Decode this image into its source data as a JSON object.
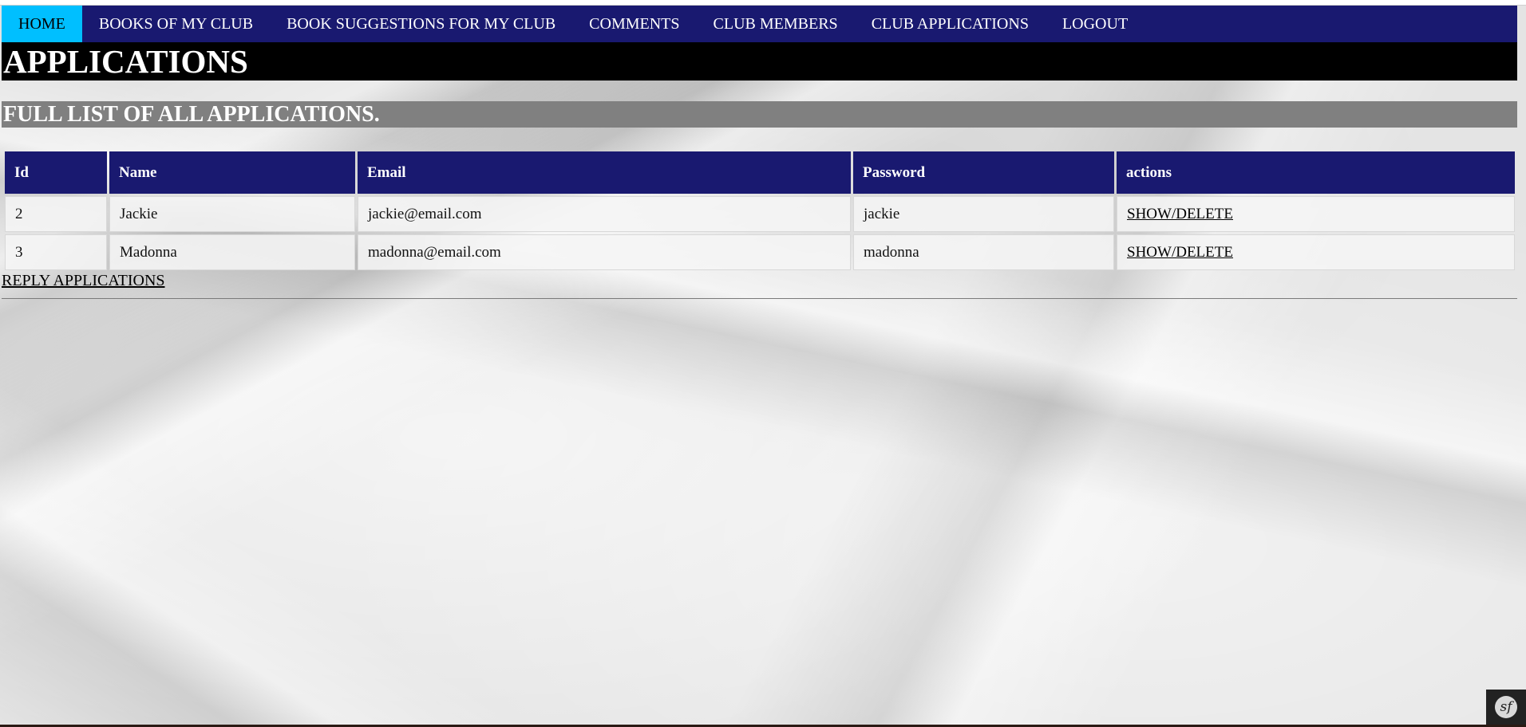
{
  "nav": {
    "items": [
      {
        "label": "HOME",
        "active": true
      },
      {
        "label": "BOOKS OF MY CLUB",
        "active": false
      },
      {
        "label": "BOOK SUGGESTIONS FOR MY CLUB",
        "active": false
      },
      {
        "label": "COMMENTS",
        "active": false
      },
      {
        "label": "CLUB MEMBERS",
        "active": false
      },
      {
        "label": "CLUB APPLICATIONS",
        "active": false
      },
      {
        "label": "LOGOUT",
        "active": false
      }
    ]
  },
  "page": {
    "title": "APPLICATIONS",
    "subtitle": "FULL LIST OF ALL APPLICATIONS."
  },
  "table": {
    "headers": [
      "Id",
      "Name",
      "Email",
      "Password",
      "actions"
    ],
    "rows": [
      {
        "id": "2",
        "name": "Jackie",
        "email": "jackie@email.com",
        "password": "jackie",
        "action": "SHOW/DELETE"
      },
      {
        "id": "3",
        "name": "Madonna",
        "email": "madonna@email.com",
        "password": "madonna",
        "action": "SHOW/DELETE"
      }
    ]
  },
  "footer": {
    "reply_link": "REPLY APPLICATIONS"
  },
  "toolbar": {
    "logo_text": "sf",
    "icon": "symfony-icon"
  },
  "colors": {
    "nav_bg": "#191970",
    "nav_active": "#00bfff",
    "title_bg": "#000000",
    "subtitle_bg": "#808080",
    "table_header_bg": "#191970"
  }
}
